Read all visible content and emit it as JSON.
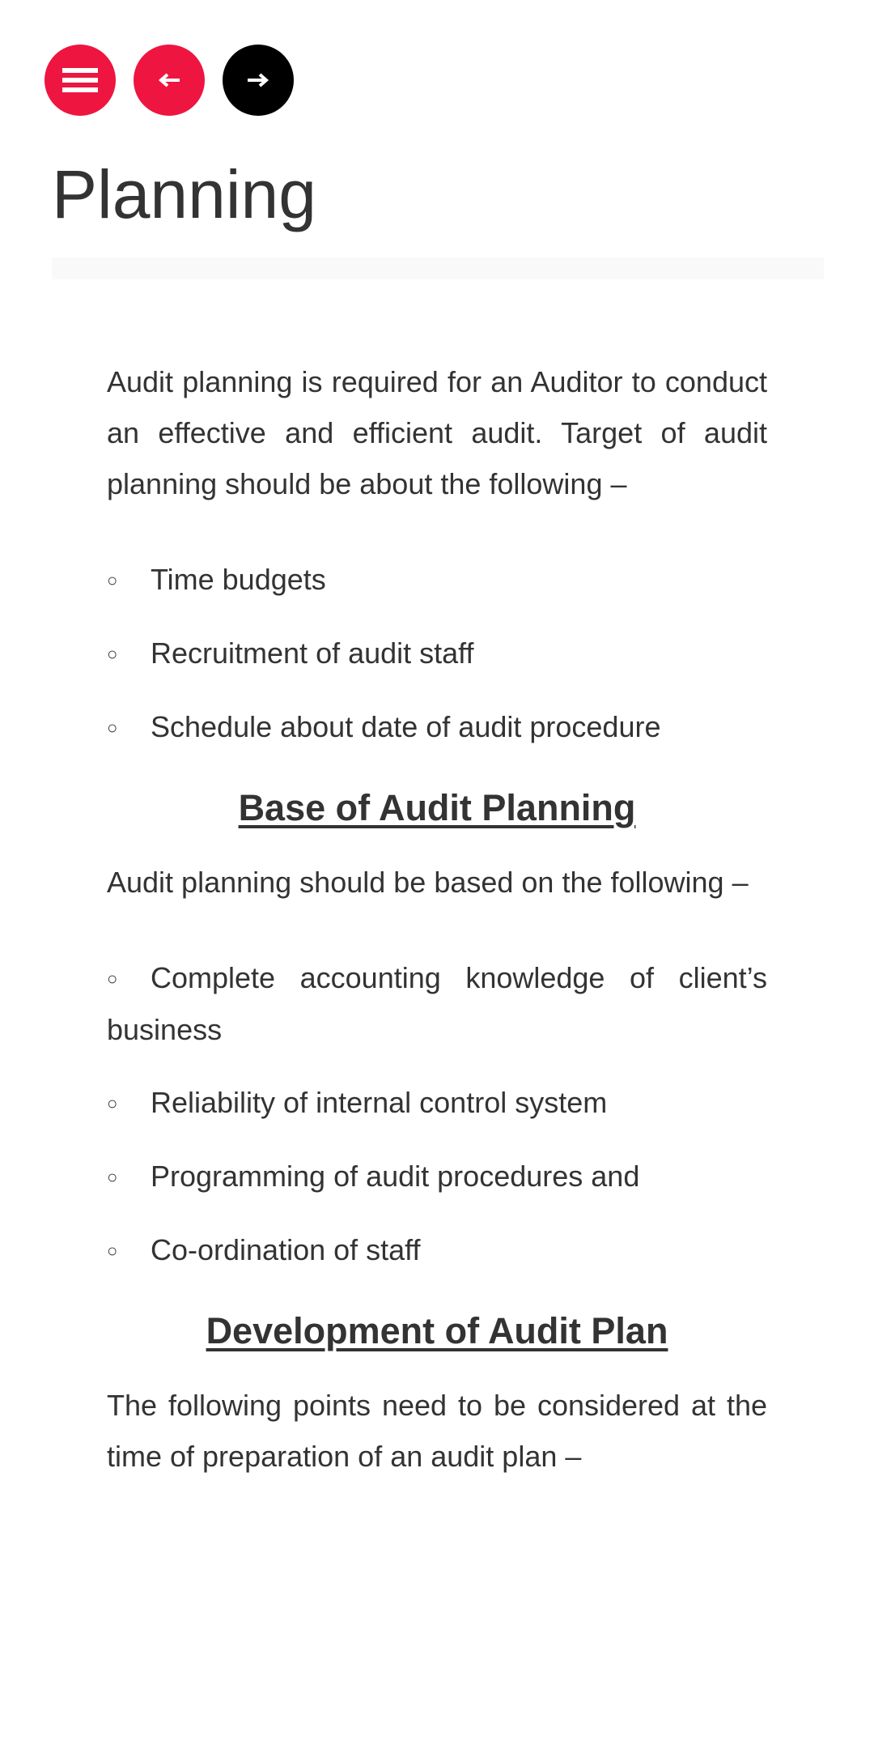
{
  "nav": {
    "menu_icon": "hamburger-menu-icon",
    "prev_icon": "arrow-left-icon",
    "next_icon": "arrow-right-icon",
    "colors": {
      "accent": "#ee1540",
      "next": "#000000",
      "icon": "#ffffff"
    }
  },
  "page": {
    "title": "Planning"
  },
  "sections": {
    "intro": {
      "text": "Audit planning is required for an Auditor to conduct an effective and efficient audit. Target of audit planning should be about the following –",
      "items": [
        "Time budgets",
        "Recruitment of audit staff",
        "Schedule about date of audit procedure"
      ]
    },
    "base": {
      "heading": "Base of Audit Planning",
      "text": "Audit planning should be based on the following –",
      "items": [
        "Complete accounting knowledge of client’s business",
        "Reliability of internal control system",
        "Programming of audit procedures and",
        "Co-ordination of staff"
      ]
    },
    "development": {
      "heading": "Development of Audit Plan",
      "text": "The following points need to be considered at the time of preparation of an audit plan –"
    }
  },
  "bullet_glyph": "○",
  "text_color": "#333333"
}
